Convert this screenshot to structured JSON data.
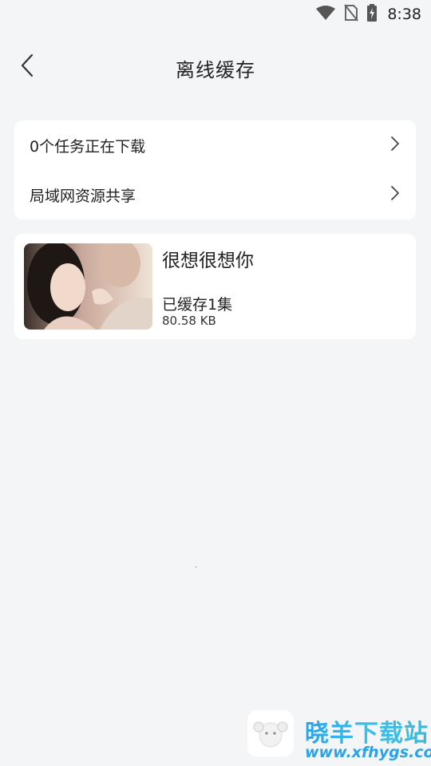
{
  "status_bar": {
    "time": "8:38",
    "icons": [
      "wifi-icon",
      "no-sim-icon",
      "battery-charging-icon"
    ]
  },
  "header": {
    "title": "离线缓存",
    "back_icon": "chevron-left-icon"
  },
  "menu": {
    "items": [
      {
        "label": "0个任务正在下载",
        "icon": "chevron-right-icon"
      },
      {
        "label": "局域网资源共享",
        "icon": "chevron-right-icon"
      }
    ]
  },
  "cache": {
    "items": [
      {
        "title": "很想很想你",
        "status": "已缓存1集",
        "size": "80.58 KB"
      }
    ]
  },
  "watermark": {
    "name": "晓羊下载站",
    "url": "www.xfhygs.com"
  },
  "colors": {
    "background": "#f4f5f7",
    "card": "#ffffff",
    "watermark_blue": "#2aa3e8"
  }
}
